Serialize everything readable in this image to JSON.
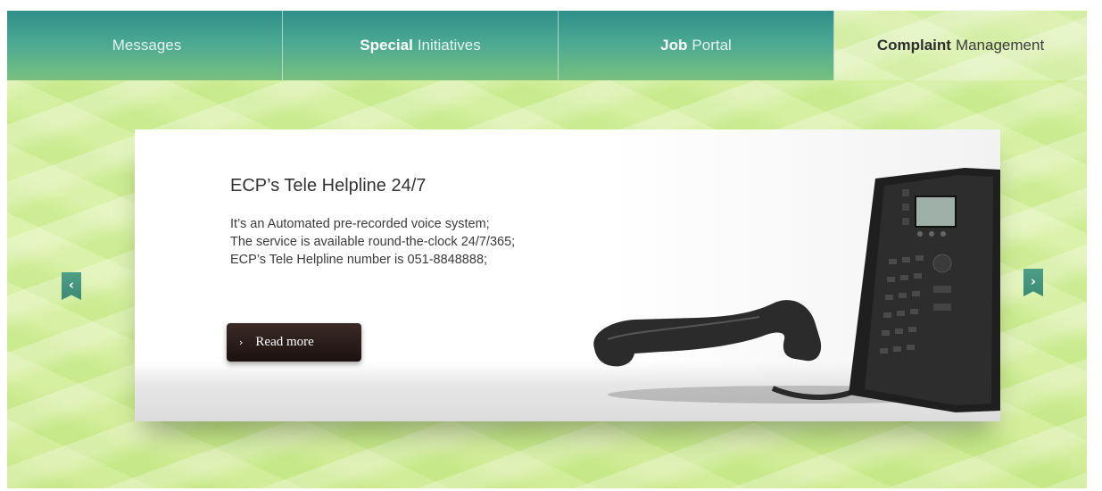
{
  "tabs": [
    {
      "bold": "",
      "text": "Messages"
    },
    {
      "bold": "Special",
      "text": "Initiatives"
    },
    {
      "bold": "Job",
      "text": "Portal"
    },
    {
      "bold": "Complaint",
      "text": "Management"
    }
  ],
  "active_tab": 3,
  "slide": {
    "title": "ECP’s Tele Helpline 24/7",
    "lines": [
      "It’s an Automated pre-recorded voice system;",
      "The service is available round-the-clock 24/7/365;",
      "ECP’s Tele Helpline number is 051-8848888;"
    ],
    "button_label": "Read more",
    "button_icon": "chevron-right-icon",
    "image": "desk-telephone-illustration"
  },
  "nav": {
    "prev_icon": "chevron-left-icon",
    "prev_glyph": "‹",
    "next_icon": "chevron-right-icon",
    "next_glyph": "›"
  },
  "colors": {
    "tab_gradient_top": "#2f8f8a",
    "tab_gradient_bottom": "#78c07f",
    "background": "#d3ee9c",
    "button": "#231714",
    "arrow": "#4a977f"
  }
}
